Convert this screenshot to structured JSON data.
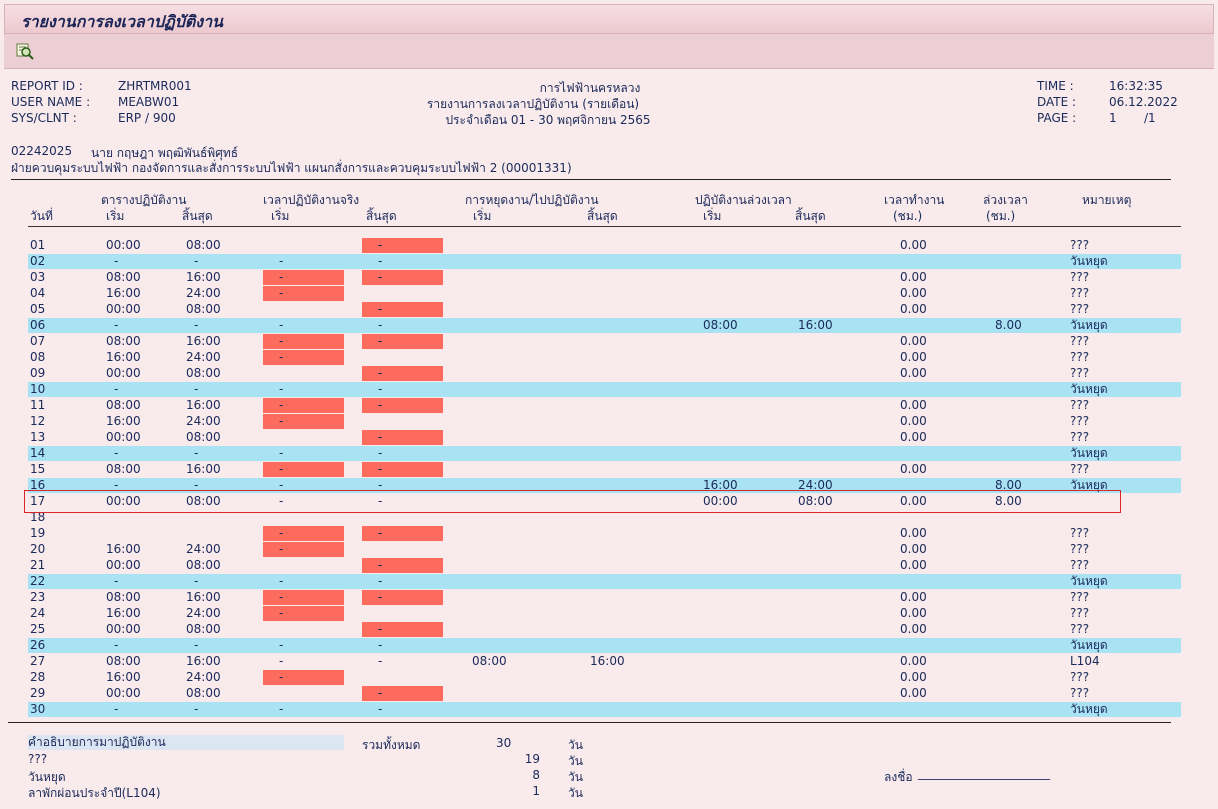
{
  "title": "รายงานการลงเวลาปฏิบัติงาน",
  "toolbar": {
    "icon": "search-detail-icon"
  },
  "report": {
    "report_id_label": "REPORT ID :",
    "report_id": "ZHRTMR001",
    "user_name_label": "USER NAME :",
    "user_name": "MEABW01",
    "sys_label": "SYS/CLNT  :",
    "sys": "ERP  / 900",
    "org": "การไฟฟ้านครหลวง",
    "report_name": "รายงานการลงเวลาปฏิบัติงาน (รายเดือน)",
    "period": "ประจำเดือน 01 - 30 พฤศจิกายน 2565",
    "time_label": "TIME :",
    "time": "16:32:35",
    "date_label": "DATE :",
    "date": "06.12.2022",
    "page_label": "PAGE :",
    "page": "1",
    "page_total": "/1"
  },
  "employee": {
    "id": "02242025",
    "name": "นาย กฤษฎา พฤฒิพันธ์พิศุทธ์",
    "unit": "ฝ่ายควบคุมระบบไฟฟ้า กองจัดการและสั่งการระบบไฟฟ้า แผนกสั่งการและควบคุมระบบไฟฟ้า 2 (00001331)"
  },
  "columns": {
    "schedule": "ตารางปฏิบัติงาน",
    "actual": "เวลาปฏิบัติงานจริง",
    "leave": "การหยุดงาน/ไปปฏิบัติงาน",
    "ot_work": "ปฏิบัติงานล่วงเวลา",
    "work_hours": "เวลาทำงาน",
    "ot": "ล่วงเวลา",
    "day": "วันที่",
    "start": "เริ่ม",
    "end": "สิ้นสุด",
    "hours_unit": "(ชม.)",
    "remark": "หมายเหตุ"
  },
  "rows": [
    {
      "day": "01",
      "s": "00:00",
      "e": "08:00",
      "as": "",
      "ae": "-",
      "red_as": false,
      "red_ae": true,
      "ls": "",
      "le": "",
      "os": "",
      "oe": "",
      "wh": "0.00",
      "ot": "",
      "rm": "???",
      "hol": false
    },
    {
      "day": "02",
      "s": "-",
      "e": "-",
      "as": "-",
      "ae": "-",
      "red_as": false,
      "red_ae": false,
      "ls": "",
      "le": "",
      "os": "",
      "oe": "",
      "wh": "",
      "ot": "",
      "rm": "วันหยุด",
      "hol": true
    },
    {
      "day": "03",
      "s": "08:00",
      "e": "16:00",
      "as": "-",
      "ae": "-",
      "red_as": true,
      "red_ae": true,
      "ls": "",
      "le": "",
      "os": "",
      "oe": "",
      "wh": "0.00",
      "ot": "",
      "rm": "???",
      "hol": false
    },
    {
      "day": "04",
      "s": "16:00",
      "e": "24:00",
      "as": "-",
      "ae": "",
      "red_as": true,
      "red_ae": false,
      "ls": "",
      "le": "",
      "os": "",
      "oe": "",
      "wh": "0.00",
      "ot": "",
      "rm": "???",
      "hol": false
    },
    {
      "day": "05",
      "s": "00:00",
      "e": "08:00",
      "as": "",
      "ae": "-",
      "red_as": false,
      "red_ae": true,
      "ls": "",
      "le": "",
      "os": "",
      "oe": "",
      "wh": "0.00",
      "ot": "",
      "rm": "???",
      "hol": false
    },
    {
      "day": "06",
      "s": "-",
      "e": "-",
      "as": "-",
      "ae": "-",
      "red_as": false,
      "red_ae": false,
      "ls": "",
      "le": "",
      "os": "08:00",
      "oe": "16:00",
      "wh": "",
      "ot": "8.00",
      "rm": "วันหยุด",
      "hol": true
    },
    {
      "day": "07",
      "s": "08:00",
      "e": "16:00",
      "as": "-",
      "ae": "-",
      "red_as": true,
      "red_ae": true,
      "ls": "",
      "le": "",
      "os": "",
      "oe": "",
      "wh": "0.00",
      "ot": "",
      "rm": "???",
      "hol": false
    },
    {
      "day": "08",
      "s": "16:00",
      "e": "24:00",
      "as": "-",
      "ae": "",
      "red_as": true,
      "red_ae": false,
      "ls": "",
      "le": "",
      "os": "",
      "oe": "",
      "wh": "0.00",
      "ot": "",
      "rm": "???",
      "hol": false
    },
    {
      "day": "09",
      "s": "00:00",
      "e": "08:00",
      "as": "",
      "ae": "-",
      "red_as": false,
      "red_ae": true,
      "ls": "",
      "le": "",
      "os": "",
      "oe": "",
      "wh": "0.00",
      "ot": "",
      "rm": "???",
      "hol": false
    },
    {
      "day": "10",
      "s": "-",
      "e": "-",
      "as": "-",
      "ae": "-",
      "red_as": false,
      "red_ae": false,
      "ls": "",
      "le": "",
      "os": "",
      "oe": "",
      "wh": "",
      "ot": "",
      "rm": "วันหยุด",
      "hol": true
    },
    {
      "day": "11",
      "s": "08:00",
      "e": "16:00",
      "as": "-",
      "ae": "-",
      "red_as": true,
      "red_ae": true,
      "ls": "",
      "le": "",
      "os": "",
      "oe": "",
      "wh": "0.00",
      "ot": "",
      "rm": "???",
      "hol": false
    },
    {
      "day": "12",
      "s": "16:00",
      "e": "24:00",
      "as": "-",
      "ae": "",
      "red_as": true,
      "red_ae": false,
      "ls": "",
      "le": "",
      "os": "",
      "oe": "",
      "wh": "0.00",
      "ot": "",
      "rm": "???",
      "hol": false
    },
    {
      "day": "13",
      "s": "00:00",
      "e": "08:00",
      "as": "",
      "ae": "-",
      "red_as": false,
      "red_ae": true,
      "ls": "",
      "le": "",
      "os": "",
      "oe": "",
      "wh": "0.00",
      "ot": "",
      "rm": "???",
      "hol": false
    },
    {
      "day": "14",
      "s": "-",
      "e": "-",
      "as": "-",
      "ae": "-",
      "red_as": false,
      "red_ae": false,
      "ls": "",
      "le": "",
      "os": "",
      "oe": "",
      "wh": "",
      "ot": "",
      "rm": "วันหยุด",
      "hol": true
    },
    {
      "day": "15",
      "s": "08:00",
      "e": "16:00",
      "as": "-",
      "ae": "-",
      "red_as": true,
      "red_ae": true,
      "ls": "",
      "le": "",
      "os": "",
      "oe": "",
      "wh": "0.00",
      "ot": "",
      "rm": "???",
      "hol": false
    },
    {
      "day": "16",
      "s": "-",
      "e": "-",
      "as": "-",
      "ae": "-",
      "red_as": false,
      "red_ae": false,
      "ls": "",
      "le": "",
      "os": "16:00",
      "oe": "24:00",
      "wh": "",
      "ot": "8.00",
      "rm": "วันหยุด",
      "hol": true
    },
    {
      "day": "17",
      "s": "00:00",
      "e": "08:00",
      "as": "-",
      "ae": "-",
      "red_as": false,
      "red_ae": false,
      "ls": "",
      "le": "",
      "os": "00:00",
      "oe": "08:00",
      "wh": "0.00",
      "ot": "8.00",
      "rm": "",
      "hol": false
    },
    {
      "day": "18",
      "s": "",
      "e": "",
      "as": "",
      "ae": "",
      "red_as": false,
      "red_ae": false,
      "ls": "",
      "le": "",
      "os": "",
      "oe": "",
      "wh": "",
      "ot": "",
      "rm": "",
      "hol": false
    },
    {
      "day": "19",
      "s": "",
      "e": "",
      "as": "-",
      "ae": "-",
      "red_as": true,
      "red_ae": true,
      "ls": "",
      "le": "",
      "os": "",
      "oe": "",
      "wh": "0.00",
      "ot": "",
      "rm": "???",
      "hol": false
    },
    {
      "day": "20",
      "s": "16:00",
      "e": "24:00",
      "as": "-",
      "ae": "",
      "red_as": true,
      "red_ae": false,
      "ls": "",
      "le": "",
      "os": "",
      "oe": "",
      "wh": "0.00",
      "ot": "",
      "rm": "???",
      "hol": false
    },
    {
      "day": "21",
      "s": "00:00",
      "e": "08:00",
      "as": "",
      "ae": "-",
      "red_as": false,
      "red_ae": true,
      "ls": "",
      "le": "",
      "os": "",
      "oe": "",
      "wh": "0.00",
      "ot": "",
      "rm": "???",
      "hol": false
    },
    {
      "day": "22",
      "s": "-",
      "e": "-",
      "as": "-",
      "ae": "-",
      "red_as": false,
      "red_ae": false,
      "ls": "",
      "le": "",
      "os": "",
      "oe": "",
      "wh": "",
      "ot": "",
      "rm": "วันหยุด",
      "hol": true
    },
    {
      "day": "23",
      "s": "08:00",
      "e": "16:00",
      "as": "-",
      "ae": "-",
      "red_as": true,
      "red_ae": true,
      "ls": "",
      "le": "",
      "os": "",
      "oe": "",
      "wh": "0.00",
      "ot": "",
      "rm": "???",
      "hol": false
    },
    {
      "day": "24",
      "s": "16:00",
      "e": "24:00",
      "as": "-",
      "ae": "",
      "red_as": true,
      "red_ae": false,
      "ls": "",
      "le": "",
      "os": "",
      "oe": "",
      "wh": "0.00",
      "ot": "",
      "rm": "???",
      "hol": false
    },
    {
      "day": "25",
      "s": "00:00",
      "e": "08:00",
      "as": "",
      "ae": "-",
      "red_as": false,
      "red_ae": true,
      "ls": "",
      "le": "",
      "os": "",
      "oe": "",
      "wh": "0.00",
      "ot": "",
      "rm": "???",
      "hol": false
    },
    {
      "day": "26",
      "s": "-",
      "e": "-",
      "as": "-",
      "ae": "-",
      "red_as": false,
      "red_ae": false,
      "ls": "",
      "le": "",
      "os": "",
      "oe": "",
      "wh": "",
      "ot": "",
      "rm": "วันหยุด",
      "hol": true
    },
    {
      "day": "27",
      "s": "08:00",
      "e": "16:00",
      "as": "-",
      "ae": "-",
      "red_as": false,
      "red_ae": false,
      "ls": "08:00",
      "le": "16:00",
      "os": "",
      "oe": "",
      "wh": "0.00",
      "ot": "",
      "rm": "L104",
      "hol": false
    },
    {
      "day": "28",
      "s": "16:00",
      "e": "24:00",
      "as": "-",
      "ae": "",
      "red_as": true,
      "red_ae": false,
      "ls": "",
      "le": "",
      "os": "",
      "oe": "",
      "wh": "0.00",
      "ot": "",
      "rm": "???",
      "hol": false
    },
    {
      "day": "29",
      "s": "00:00",
      "e": "08:00",
      "as": "",
      "ae": "-",
      "red_as": false,
      "red_ae": true,
      "ls": "",
      "le": "",
      "os": "",
      "oe": "",
      "wh": "0.00",
      "ot": "",
      "rm": "???",
      "hol": false
    },
    {
      "day": "30",
      "s": "-",
      "e": "-",
      "as": "-",
      "ae": "-",
      "red_as": false,
      "red_ae": false,
      "ls": "",
      "le": "",
      "os": "",
      "oe": "",
      "wh": "",
      "ot": "",
      "rm": "วันหยุด",
      "hol": true
    }
  ],
  "summary": {
    "heading": "คำอธิบายการมาปฏิบัติงาน",
    "total_label": "รวมทั้งหมด",
    "total": "30",
    "unit": "วัน",
    "items": [
      {
        "label": "???",
        "value": "19",
        "unit": "วัน"
      },
      {
        "label": "วันหยุด",
        "value": "8",
        "unit": "วัน"
      },
      {
        "label": "ลาพักผ่อนประจำปี(L104)",
        "value": "1",
        "unit": "วัน"
      }
    ],
    "sign_label": "ลงชื่อ",
    "sign_line": "______________________"
  },
  "colors": {
    "holiday_row": "#a9e3f3",
    "missing_cell": "#fd6a5e",
    "highlight": "#d8262c",
    "background": "#f9eaec"
  }
}
